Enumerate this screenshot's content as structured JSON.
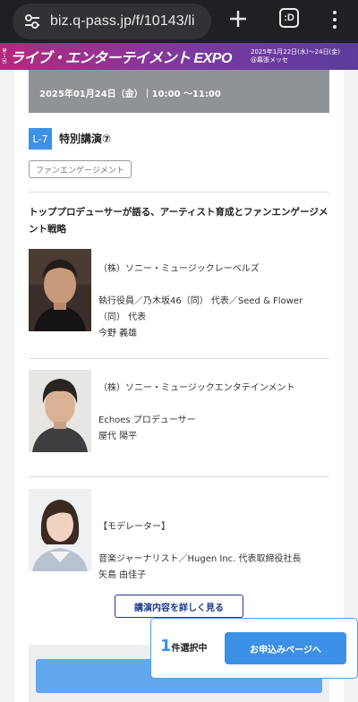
{
  "browser": {
    "url": "biz.q-pass.jp/f/10143/li",
    "tab_count": ":D"
  },
  "banner": {
    "edition": "第1回",
    "title": "ライブ・エンターテイメント EXPO",
    "dates": "2025年1月22日(水)〜24日(金)",
    "venue": "@幕張メッセ"
  },
  "session": {
    "datetime": "2025年01月24日（金）｜10:00 〜11:00",
    "code": "L-7",
    "name": "特別講演⑦",
    "category": "ファンエンゲージメント",
    "title": "トッププロデューサーが語る、アーティスト育成とファンエンゲージメント戦略"
  },
  "speakers": [
    {
      "company": "（株）ソニー・ミュージックレーベルズ",
      "role_line1": "執行役員／乃木坂46（同） 代表／Seed & Flower",
      "role_line2": "（同） 代表",
      "name": "今野 義雄"
    },
    {
      "company": "（株）ソニー・ミュージックエンタテインメント",
      "role_line1": "Echoes プロデューサー",
      "name": "屋代 陽平"
    },
    {
      "company": "【モデレーター】",
      "role_line1": "音楽ジャーナリスト／Hugen Inc. 代表取締役社長",
      "name": "矢島 由佳子"
    }
  ],
  "buttons": {
    "details": "講演内容を詳しく見る",
    "apply": "お申込みページへ"
  },
  "selection": {
    "count": "1",
    "label": "件選択中"
  },
  "colors": {
    "accent_blue": "#3c91e6",
    "navy": "#1e3a8a",
    "banner_magenta": "#b32a7d",
    "banner_purple": "#5b3c9d"
  }
}
